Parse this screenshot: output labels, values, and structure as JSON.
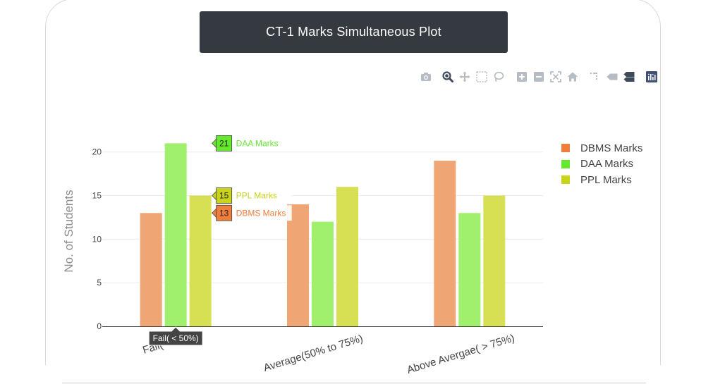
{
  "header": {
    "title": "CT-1 Marks Simultaneous Plot"
  },
  "modebar": {
    "buttons": [
      {
        "name": "camera-icon",
        "active": false
      },
      {
        "name": "zoom-icon",
        "active": true
      },
      {
        "name": "pan-icon",
        "active": false
      },
      {
        "name": "box-select-icon",
        "active": false
      },
      {
        "name": "lasso-select-icon",
        "active": false
      },
      {
        "name": "zoom-in-icon",
        "active": false
      },
      {
        "name": "zoom-out-icon",
        "active": false
      },
      {
        "name": "autoscale-icon",
        "active": false
      },
      {
        "name": "reset-axes-icon",
        "active": false
      },
      {
        "name": "spike-lines-icon",
        "active": false
      },
      {
        "name": "hover-closest-icon",
        "active": false
      },
      {
        "name": "hover-compare-icon",
        "active": false
      },
      {
        "name": "plotly-logo-icon",
        "active": false
      }
    ]
  },
  "chart_data": {
    "type": "bar",
    "title": "",
    "xlabel": "",
    "ylabel": "No. of Students",
    "ylim": [
      0,
      22
    ],
    "yticks": [
      0,
      5,
      10,
      15,
      20
    ],
    "ytick_labels": [
      "0",
      "5",
      "10",
      "15",
      "20"
    ],
    "categories": [
      "Fail( < 50%)",
      "Average(50% to 75%)",
      "Above Avergae( > 75%)"
    ],
    "xtick_labels": [
      "Fail( <",
      "Average(50% to 75%)",
      "Above Avergae( > 75%)"
    ],
    "series": [
      {
        "name": "DBMS Marks",
        "values": [
          13,
          14,
          19
        ],
        "color": "#ef7d3c",
        "bar_color": "#f0a575"
      },
      {
        "name": "DAA Marks",
        "values": [
          21,
          12,
          13
        ],
        "color": "#66e82f",
        "bar_color": "#a0ef6d"
      },
      {
        "name": "PPL Marks",
        "values": [
          15,
          16,
          15
        ],
        "color": "#c8d41a",
        "bar_color": "#d7e052"
      }
    ],
    "grid": true,
    "legend_position": "right",
    "hover": {
      "category_index": 0,
      "x_label": "Fail( < 50%)",
      "labels": [
        {
          "series": "DAA Marks",
          "value": "21"
        },
        {
          "series": "PPL Marks",
          "value": "15"
        },
        {
          "series": "DBMS Marks",
          "value": "13"
        }
      ]
    }
  }
}
